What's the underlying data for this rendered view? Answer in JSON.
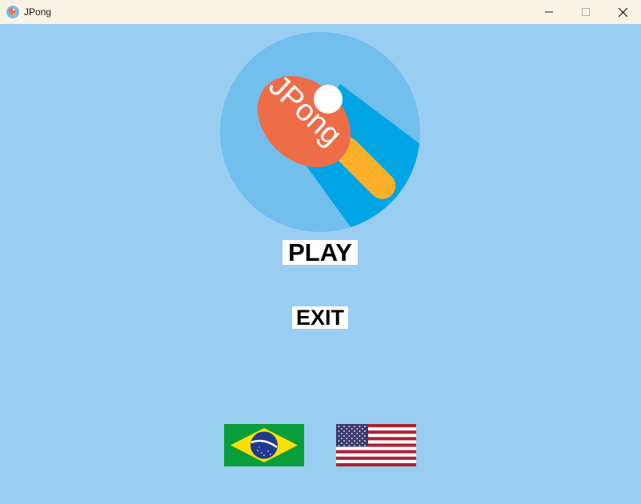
{
  "window": {
    "title": "JPong",
    "icon": "jpong-app-icon"
  },
  "controls": {
    "minimize_icon": "minimize-icon",
    "maximize_icon": "maximize-icon",
    "close_icon": "close-icon"
  },
  "logo": {
    "text": "JPong",
    "icon": "ping-pong-paddle-icon"
  },
  "menu": {
    "play_label": "PLAY",
    "exit_label": "EXIT"
  },
  "languages": [
    {
      "name": "brazil-flag"
    },
    {
      "name": "usa-flag"
    }
  ],
  "colors": {
    "background": "#99CEF2",
    "titlebar": "#FBF3E6",
    "logo_circle": "#72BEEC",
    "logo_shadow": "#00A5E4",
    "paddle": "#EE6D49",
    "handle": "#FDB02A",
    "ball": "#FFFFFF"
  }
}
